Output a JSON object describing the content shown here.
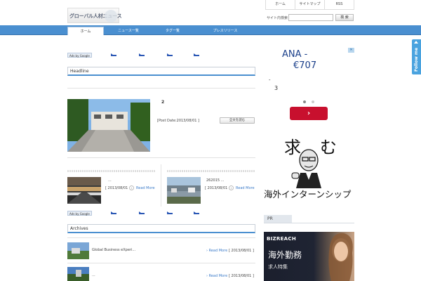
{
  "header": {
    "logo_text": "グローバル人材ニュース",
    "top_links": [
      "ホーム",
      "サイトマップ",
      "RSS"
    ],
    "search_label": "サイト内検索",
    "search_placeholder": "",
    "search_button": "検 索"
  },
  "nav": {
    "items": [
      "ホーム",
      "ニュース一覧",
      "タグ一覧",
      "プレスリリース"
    ],
    "active_index": 0
  },
  "follow_tab": {
    "label": "Follow me"
  },
  "main": {
    "ads_badge_top": "Ads by Google",
    "ads_badge_bottom": "Ads by Google",
    "headline": {
      "section_title": "Headline",
      "item_title": "2",
      "post_date": "[Post Date:2013/08/01 ]",
      "full_text_button": "全文を読む"
    },
    "sub_articles": [
      {
        "title": "...",
        "date": "[ 2013/08/01",
        "read_more": "Read More"
      },
      {
        "title": "262015 ...",
        "date": "[ 2013/08/01",
        "read_more": "Read More"
      }
    ],
    "archives": {
      "section_title": "Archives",
      "items": [
        {
          "title": "Global Business eXperi...",
          "read_more": "Read More",
          "date": "[ 2013/08/01 ]"
        },
        {
          "title": "...",
          "read_more": "Read More",
          "date": "[ 2013/08/01 ]"
        }
      ]
    }
  },
  "sidebar": {
    "ad": {
      "close_label": "✕",
      "airline": "ANA -",
      "price": "€707",
      "line_a": "-",
      "line_b": "3",
      "next_glyph": "›",
      "image_text_top": "求",
      "image_text_top2": "む",
      "image_text_bottom": "海外インターンシップ"
    },
    "pr_label": "PR",
    "pr_banner": {
      "brand": "BIZREACH",
      "headline": "海外勤務",
      "subline": "求人特集"
    }
  },
  "colors": {
    "nav_blue": "#4a8fd0",
    "link_blue": "#3d7cc9",
    "ana_blue": "#1a3f8a",
    "ad_red": "#c8102e",
    "follow_blue": "#4aa3df"
  }
}
